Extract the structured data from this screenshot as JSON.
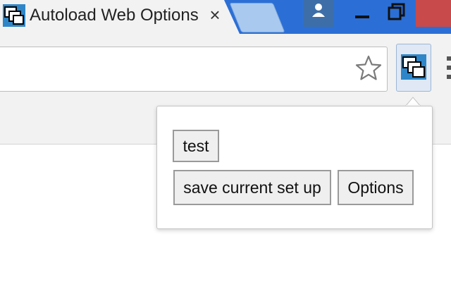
{
  "window": {
    "tab_title": "Autoload Web Options",
    "tab_close_glyph": "×",
    "colors": {
      "titlebar": "#2b6fd6",
      "close_button": "#c84a4a",
      "toolbar": "#f2f2f2"
    }
  },
  "toolbar": {
    "omnibox_value": "",
    "bookmark_icon": "star-icon",
    "extension_icon": "autoload-extension-icon"
  },
  "popup": {
    "buttons": {
      "test": "test",
      "save": "save current set up",
      "options": "Options"
    }
  }
}
